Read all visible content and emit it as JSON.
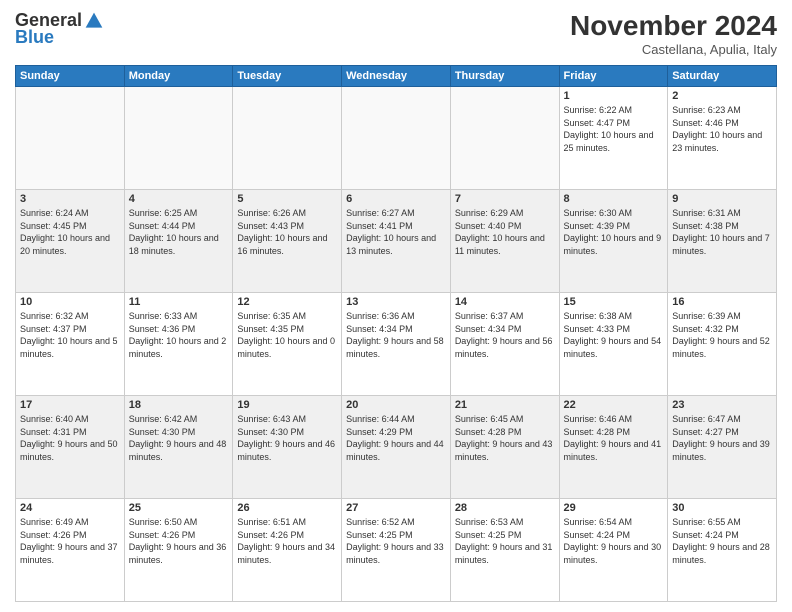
{
  "logo": {
    "general": "General",
    "blue": "Blue"
  },
  "header": {
    "month": "November 2024",
    "location": "Castellana, Apulia, Italy"
  },
  "weekdays": [
    "Sunday",
    "Monday",
    "Tuesday",
    "Wednesday",
    "Thursday",
    "Friday",
    "Saturday"
  ],
  "weeks": [
    [
      {
        "day": "",
        "info": ""
      },
      {
        "day": "",
        "info": ""
      },
      {
        "day": "",
        "info": ""
      },
      {
        "day": "",
        "info": ""
      },
      {
        "day": "",
        "info": ""
      },
      {
        "day": "1",
        "info": "Sunrise: 6:22 AM\nSunset: 4:47 PM\nDaylight: 10 hours and 25 minutes."
      },
      {
        "day": "2",
        "info": "Sunrise: 6:23 AM\nSunset: 4:46 PM\nDaylight: 10 hours and 23 minutes."
      }
    ],
    [
      {
        "day": "3",
        "info": "Sunrise: 6:24 AM\nSunset: 4:45 PM\nDaylight: 10 hours and 20 minutes."
      },
      {
        "day": "4",
        "info": "Sunrise: 6:25 AM\nSunset: 4:44 PM\nDaylight: 10 hours and 18 minutes."
      },
      {
        "day": "5",
        "info": "Sunrise: 6:26 AM\nSunset: 4:43 PM\nDaylight: 10 hours and 16 minutes."
      },
      {
        "day": "6",
        "info": "Sunrise: 6:27 AM\nSunset: 4:41 PM\nDaylight: 10 hours and 13 minutes."
      },
      {
        "day": "7",
        "info": "Sunrise: 6:29 AM\nSunset: 4:40 PM\nDaylight: 10 hours and 11 minutes."
      },
      {
        "day": "8",
        "info": "Sunrise: 6:30 AM\nSunset: 4:39 PM\nDaylight: 10 hours and 9 minutes."
      },
      {
        "day": "9",
        "info": "Sunrise: 6:31 AM\nSunset: 4:38 PM\nDaylight: 10 hours and 7 minutes."
      }
    ],
    [
      {
        "day": "10",
        "info": "Sunrise: 6:32 AM\nSunset: 4:37 PM\nDaylight: 10 hours and 5 minutes."
      },
      {
        "day": "11",
        "info": "Sunrise: 6:33 AM\nSunset: 4:36 PM\nDaylight: 10 hours and 2 minutes."
      },
      {
        "day": "12",
        "info": "Sunrise: 6:35 AM\nSunset: 4:35 PM\nDaylight: 10 hours and 0 minutes."
      },
      {
        "day": "13",
        "info": "Sunrise: 6:36 AM\nSunset: 4:34 PM\nDaylight: 9 hours and 58 minutes."
      },
      {
        "day": "14",
        "info": "Sunrise: 6:37 AM\nSunset: 4:34 PM\nDaylight: 9 hours and 56 minutes."
      },
      {
        "day": "15",
        "info": "Sunrise: 6:38 AM\nSunset: 4:33 PM\nDaylight: 9 hours and 54 minutes."
      },
      {
        "day": "16",
        "info": "Sunrise: 6:39 AM\nSunset: 4:32 PM\nDaylight: 9 hours and 52 minutes."
      }
    ],
    [
      {
        "day": "17",
        "info": "Sunrise: 6:40 AM\nSunset: 4:31 PM\nDaylight: 9 hours and 50 minutes."
      },
      {
        "day": "18",
        "info": "Sunrise: 6:42 AM\nSunset: 4:30 PM\nDaylight: 9 hours and 48 minutes."
      },
      {
        "day": "19",
        "info": "Sunrise: 6:43 AM\nSunset: 4:30 PM\nDaylight: 9 hours and 46 minutes."
      },
      {
        "day": "20",
        "info": "Sunrise: 6:44 AM\nSunset: 4:29 PM\nDaylight: 9 hours and 44 minutes."
      },
      {
        "day": "21",
        "info": "Sunrise: 6:45 AM\nSunset: 4:28 PM\nDaylight: 9 hours and 43 minutes."
      },
      {
        "day": "22",
        "info": "Sunrise: 6:46 AM\nSunset: 4:28 PM\nDaylight: 9 hours and 41 minutes."
      },
      {
        "day": "23",
        "info": "Sunrise: 6:47 AM\nSunset: 4:27 PM\nDaylight: 9 hours and 39 minutes."
      }
    ],
    [
      {
        "day": "24",
        "info": "Sunrise: 6:49 AM\nSunset: 4:26 PM\nDaylight: 9 hours and 37 minutes."
      },
      {
        "day": "25",
        "info": "Sunrise: 6:50 AM\nSunset: 4:26 PM\nDaylight: 9 hours and 36 minutes."
      },
      {
        "day": "26",
        "info": "Sunrise: 6:51 AM\nSunset: 4:26 PM\nDaylight: 9 hours and 34 minutes."
      },
      {
        "day": "27",
        "info": "Sunrise: 6:52 AM\nSunset: 4:25 PM\nDaylight: 9 hours and 33 minutes."
      },
      {
        "day": "28",
        "info": "Sunrise: 6:53 AM\nSunset: 4:25 PM\nDaylight: 9 hours and 31 minutes."
      },
      {
        "day": "29",
        "info": "Sunrise: 6:54 AM\nSunset: 4:24 PM\nDaylight: 9 hours and 30 minutes."
      },
      {
        "day": "30",
        "info": "Sunrise: 6:55 AM\nSunset: 4:24 PM\nDaylight: 9 hours and 28 minutes."
      }
    ]
  ]
}
